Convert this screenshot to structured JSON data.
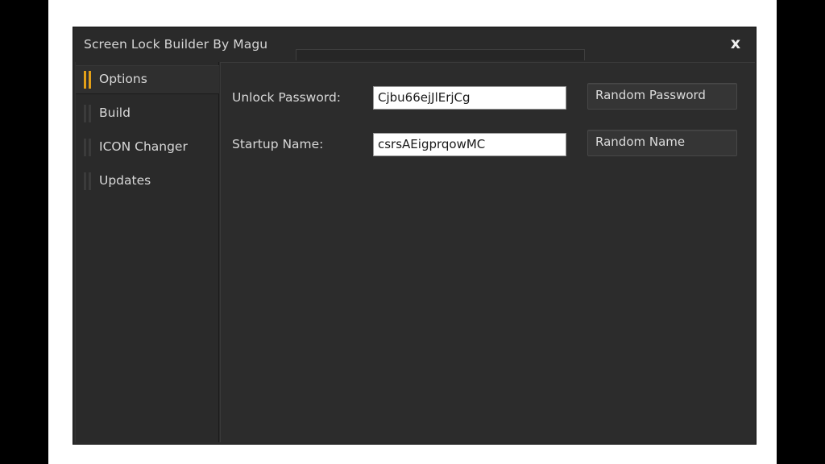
{
  "window": {
    "title": "Screen Lock Builder By Magu",
    "close_glyph": "x"
  },
  "sidebar": {
    "items": [
      {
        "label": "Options",
        "active": true
      },
      {
        "label": "Build",
        "active": false
      },
      {
        "label": "ICON Changer",
        "active": false
      },
      {
        "label": "Updates",
        "active": false
      }
    ]
  },
  "options": {
    "password_label": "Unlock Password:",
    "password_value": "Cjbu66ejJlErjCg",
    "random_password_button": "Random Password",
    "startup_label": "Startup Name:",
    "startup_value": "csrsAEigprqowMC",
    "random_name_button": "Random Name"
  },
  "colors": {
    "accent": "#e3a018",
    "background": "#2b2b2b",
    "text": "#d8d8d8"
  }
}
